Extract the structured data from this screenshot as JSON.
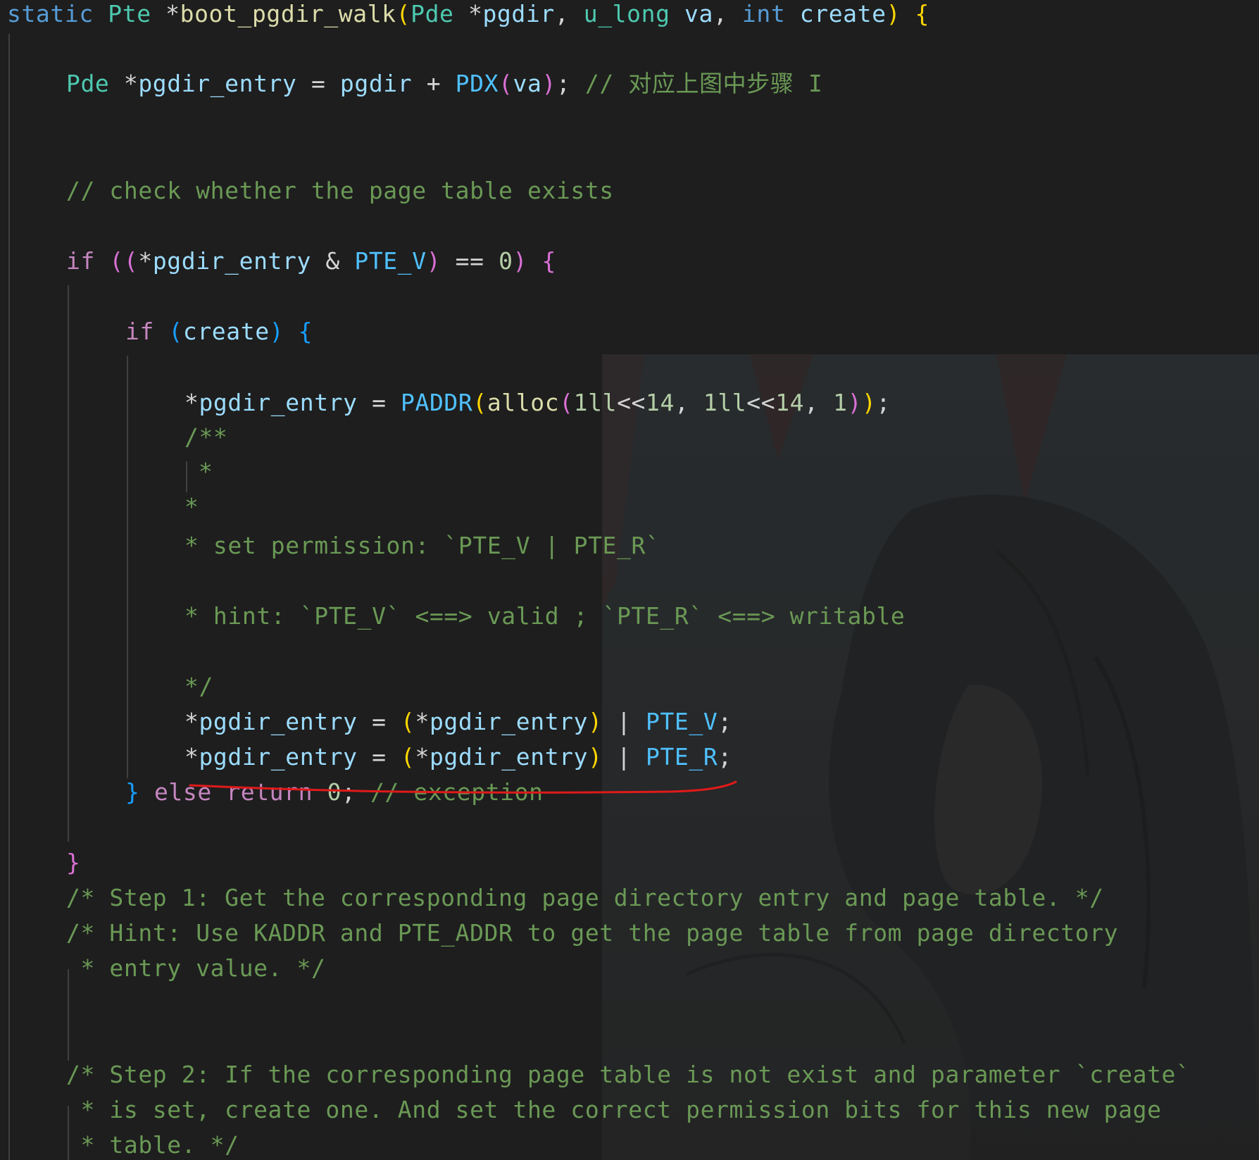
{
  "editor": {
    "lines": [
      {
        "tokens": [
          [
            "kw",
            "static"
          ],
          [
            "p",
            " "
          ],
          [
            "type",
            "Pte"
          ],
          [
            "p",
            " *"
          ],
          [
            "fn",
            "boot_pgdir_walk"
          ],
          [
            "b1",
            "("
          ],
          [
            "type",
            "Pde"
          ],
          [
            "p",
            " *"
          ],
          [
            "id",
            "pgdir"
          ],
          [
            "p",
            ", "
          ],
          [
            "type",
            "u_long"
          ],
          [
            "p",
            " "
          ],
          [
            "id",
            "va"
          ],
          [
            "p",
            ", "
          ],
          [
            "kw",
            "int"
          ],
          [
            "p",
            " "
          ],
          [
            "id",
            "create"
          ],
          [
            "b1",
            ")"
          ],
          [
            "p",
            " "
          ],
          [
            "b1",
            "{"
          ]
        ]
      },
      {
        "tokens": [
          [
            "type",
            "Pde"
          ],
          [
            "p",
            " *"
          ],
          [
            "id",
            "pgdir_entry"
          ],
          [
            "p",
            " = "
          ],
          [
            "id",
            "pgdir"
          ],
          [
            "p",
            " + "
          ],
          [
            "mac",
            "PDX"
          ],
          [
            "b2",
            "("
          ],
          [
            "id",
            "va"
          ],
          [
            "b2",
            ")"
          ],
          [
            "p",
            "; "
          ],
          [
            "cm",
            "// 对应上图中步骤 I"
          ]
        ]
      },
      {
        "tokens": [
          [
            "cm",
            "// check whether the page table exists"
          ]
        ]
      },
      {
        "tokens": [
          [
            "ctl",
            "if"
          ],
          [
            "p",
            " "
          ],
          [
            "b2",
            "(("
          ],
          [
            "p",
            "*"
          ],
          [
            "id",
            "pgdir_entry"
          ],
          [
            "p",
            " & "
          ],
          [
            "mac",
            "PTE_V"
          ],
          [
            "b2",
            ")"
          ],
          [
            "p",
            " == "
          ],
          [
            "num",
            "0"
          ],
          [
            "b2",
            ")"
          ],
          [
            "p",
            " "
          ],
          [
            "b2",
            "{"
          ]
        ]
      },
      {
        "tokens": [
          [
            "ctl",
            "if"
          ],
          [
            "p",
            " "
          ],
          [
            "b3",
            "("
          ],
          [
            "id",
            "create"
          ],
          [
            "b3",
            ")"
          ],
          [
            "p",
            " "
          ],
          [
            "b3",
            "{"
          ]
        ]
      },
      {
        "tokens": [
          [
            "p",
            "*"
          ],
          [
            "id",
            "pgdir_entry"
          ],
          [
            "p",
            " = "
          ],
          [
            "mac",
            "PADDR"
          ],
          [
            "b1",
            "("
          ],
          [
            "fn",
            "alloc"
          ],
          [
            "b2",
            "("
          ],
          [
            "num",
            "1ll"
          ],
          [
            "p",
            "<<"
          ],
          [
            "num",
            "14"
          ],
          [
            "p",
            ", "
          ],
          [
            "num",
            "1ll"
          ],
          [
            "p",
            "<<"
          ],
          [
            "num",
            "14"
          ],
          [
            "p",
            ", "
          ],
          [
            "num",
            "1"
          ],
          [
            "b2",
            ")"
          ],
          [
            "b1",
            ")"
          ],
          [
            "p",
            ";"
          ]
        ]
      },
      {
        "tokens": [
          [
            "cm",
            "/**"
          ]
        ]
      },
      {
        "tokens": [
          [
            "cm",
            "*"
          ]
        ]
      },
      {
        "tokens": [
          [
            "cm",
            "*"
          ]
        ]
      },
      {
        "tokens": [
          [
            "cm",
            "* set permission: `PTE_V | PTE_R`"
          ]
        ]
      },
      {
        "tokens": [
          [
            "cm",
            "* hint: `PTE_V` <==> valid ; `PTE_R` <==> writable"
          ]
        ]
      },
      {
        "tokens": [
          [
            "cm",
            "*/"
          ]
        ]
      },
      {
        "tokens": [
          [
            "p",
            "*"
          ],
          [
            "id",
            "pgdir_entry"
          ],
          [
            "p",
            " = "
          ],
          [
            "b1",
            "("
          ],
          [
            "p",
            "*"
          ],
          [
            "id",
            "pgdir_entry"
          ],
          [
            "b1",
            ")"
          ],
          [
            "p",
            " | "
          ],
          [
            "mac",
            "PTE_V"
          ],
          [
            "p",
            ";"
          ]
        ]
      },
      {
        "tokens": [
          [
            "p",
            "*"
          ],
          [
            "id",
            "pgdir_entry"
          ],
          [
            "p",
            " = "
          ],
          [
            "b1",
            "("
          ],
          [
            "p",
            "*"
          ],
          [
            "id",
            "pgdir_entry"
          ],
          [
            "b1",
            ")"
          ],
          [
            "p",
            " | "
          ],
          [
            "mac",
            "PTE_R"
          ],
          [
            "p",
            ";"
          ]
        ]
      },
      {
        "tokens": [
          [
            "b3",
            "}"
          ],
          [
            "p",
            " "
          ],
          [
            "ctl",
            "else"
          ],
          [
            "p",
            " "
          ],
          [
            "ctl",
            "return"
          ],
          [
            "p",
            " "
          ],
          [
            "num",
            "0"
          ],
          [
            "p",
            "; "
          ],
          [
            "cm",
            "// exception"
          ]
        ]
      },
      {
        "tokens": [
          [
            "b2",
            "}"
          ]
        ]
      },
      {
        "tokens": [
          [
            "cm",
            "/* Step 1: Get the corresponding page directory entry and page table. */"
          ]
        ]
      },
      {
        "tokens": [
          [
            "cm",
            "/* Hint: Use KADDR and PTE_ADDR to get the page table from page directory"
          ]
        ]
      },
      {
        "tokens": [
          [
            "cm",
            " * entry value. */"
          ]
        ]
      },
      {
        "tokens": [
          [
            "cm",
            "/* Step 2: If the corresponding page table is not exist and parameter `create`"
          ]
        ]
      },
      {
        "tokens": [
          [
            "cm",
            " * is set, create one. And set the correct permission bits for this new page"
          ]
        ]
      },
      {
        "tokens": [
          [
            "cm",
            " * table. */"
          ]
        ]
      }
    ]
  }
}
